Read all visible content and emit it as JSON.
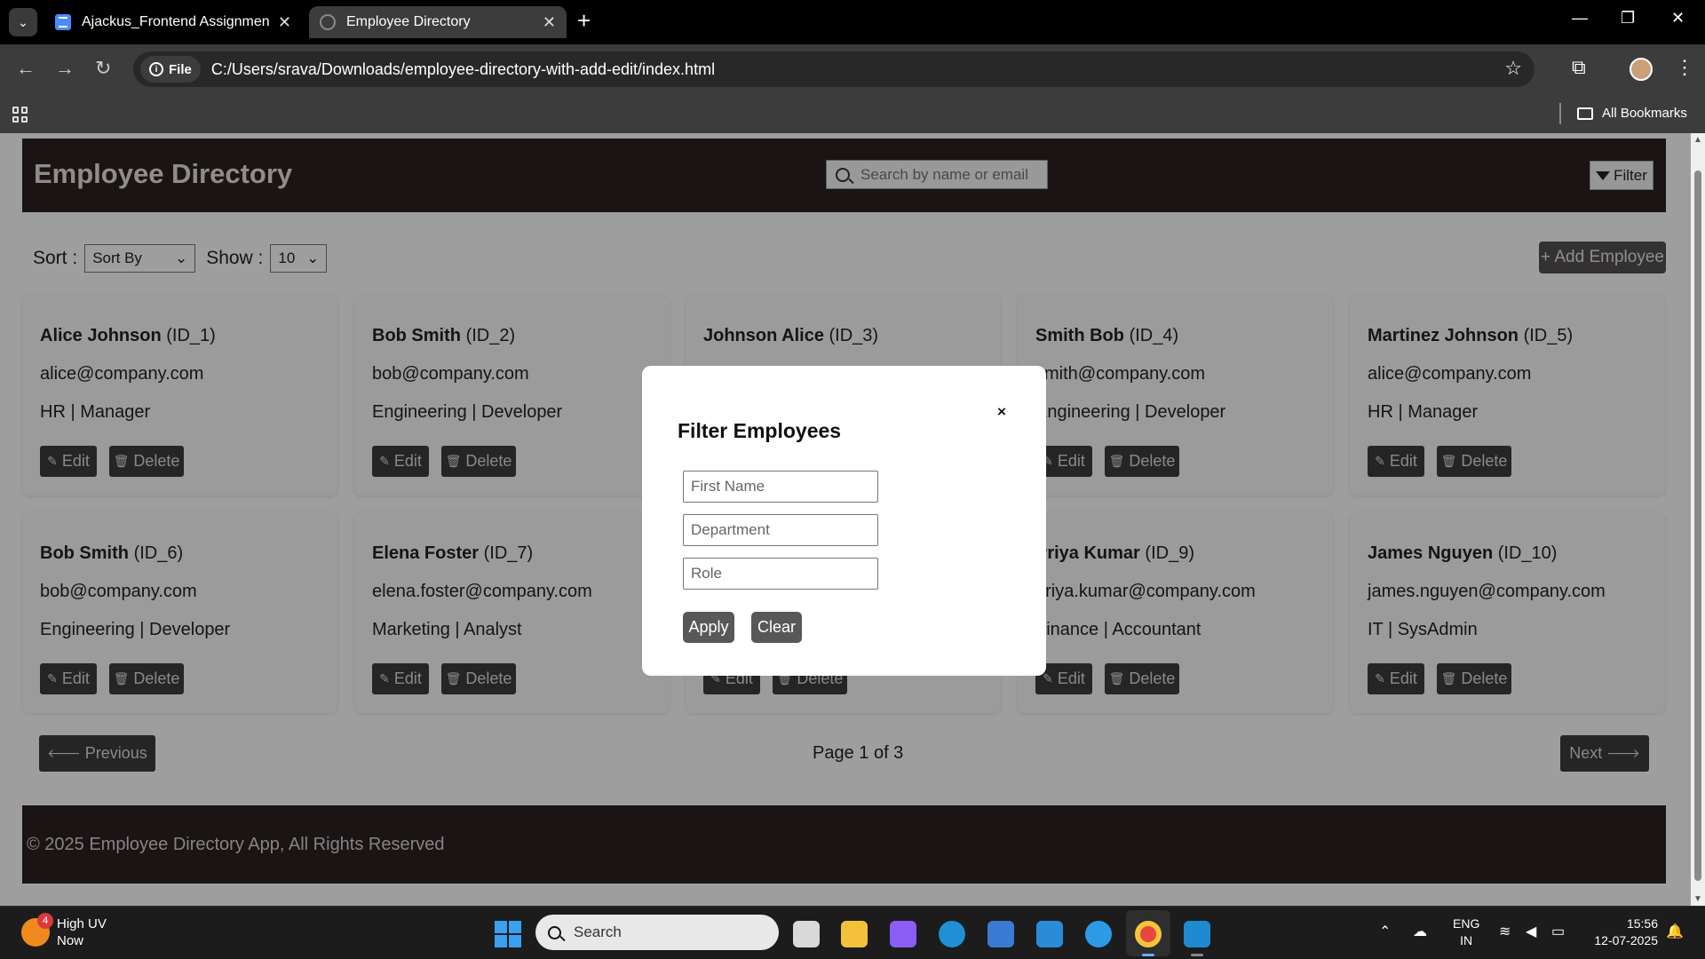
{
  "browser": {
    "tabs": [
      {
        "title": "Ajackus_Frontend Assignment -",
        "active": false
      },
      {
        "title": "Employee Directory",
        "active": true
      }
    ],
    "file_label": "File",
    "url": "C:/Users/srava/Downloads/employee-directory-with-add-edit/index.html",
    "all_bookmarks": "All Bookmarks"
  },
  "app": {
    "title": "Employee Directory",
    "search_placeholder": "Search by name or email",
    "filter_label": "Filter",
    "sort_label": "Sort :",
    "sort_value": "Sort By",
    "show_label": "Show :",
    "show_value": "10",
    "add_employee": "+ Add Employee",
    "edit_label": "Edit",
    "delete_label": "Delete",
    "employees": [
      {
        "name": "Alice Johnson",
        "id": "(ID_1)",
        "email": "alice@company.com",
        "dept_role": "HR | Manager"
      },
      {
        "name": "Bob Smith",
        "id": "(ID_2)",
        "email": "bob@company.com",
        "dept_role": "Engineering | Developer"
      },
      {
        "name": "Johnson Alice",
        "id": "(ID_3)",
        "email": "",
        "dept_role": ""
      },
      {
        "name": "Smith Bob",
        "id": "(ID_4)",
        "email": "smith@company.com",
        "dept_role": "Engineering | Developer"
      },
      {
        "name": "Martinez Johnson",
        "id": "(ID_5)",
        "email": "alice@company.com",
        "dept_role": "HR | Manager"
      },
      {
        "name": "Bob Smith",
        "id": "(ID_6)",
        "email": "bob@company.com",
        "dept_role": "Engineering | Developer"
      },
      {
        "name": "Elena Foster",
        "id": "(ID_7)",
        "email": "elena.foster@company.com",
        "dept_role": "Marketing | Analyst"
      },
      {
        "name": "",
        "id": "",
        "email": "",
        "dept_role": ""
      },
      {
        "name": "Priya Kumar",
        "id": "(ID_9)",
        "email": "priya.kumar@company.com",
        "dept_role": "Finance | Accountant"
      },
      {
        "name": "James Nguyen",
        "id": "(ID_10)",
        "email": "james.nguyen@company.com",
        "dept_role": "IT | SysAdmin"
      }
    ],
    "previous": "Previous",
    "page_info": "Page 1 of 3",
    "next": "Next",
    "footer": "© 2025 Employee Directory App, All Rights Reserved"
  },
  "modal": {
    "title": "Filter Employees",
    "close": "×",
    "first_name_placeholder": "First Name",
    "department_placeholder": "Department",
    "role_placeholder": "Role",
    "apply": "Apply",
    "clear": "Clear"
  },
  "taskbar": {
    "weather_badge": "4",
    "weather_title": "High UV",
    "weather_sub": "Now",
    "search": "Search",
    "lang_1": "ENG",
    "lang_2": "IN",
    "time": "15:56",
    "date": "12-07-2025"
  }
}
